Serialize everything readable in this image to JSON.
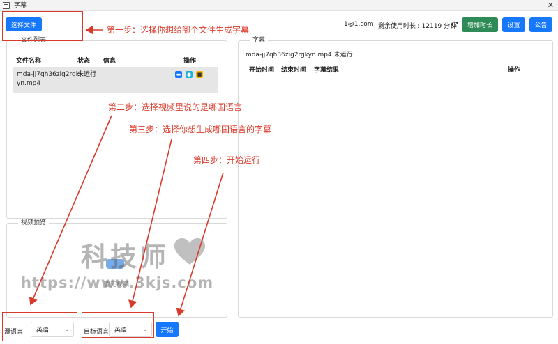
{
  "window": {
    "title": "字幕",
    "close_glyph": "✕"
  },
  "toolbar": {
    "select_file_label": "选择文件",
    "account": "1@1.com",
    "remaining_time_text": "| 剩余使用时长 : 12119 分钟",
    "add_time_label": "增加时长",
    "settings_label": "设置",
    "announcement_label": "公告"
  },
  "file_list": {
    "legend": "文件列表",
    "columns": [
      "文件名称",
      "状态",
      "信息",
      "操作"
    ],
    "rows": [
      {
        "name_line1": "mda-jj7qh36zig2rgk",
        "name_line2": "yn.mp4",
        "status": "未运行",
        "info": ""
      }
    ]
  },
  "video_preview": {
    "legend": "视频预览",
    "placeholder_text": "暂无视频"
  },
  "subtitle_panel": {
    "legend": "字幕",
    "file_status": "mda-jj7qh36zig2rgkyn.mp4 未运行",
    "columns": [
      "开始时间",
      "结束时间",
      "字幕结果",
      "操作"
    ]
  },
  "bottom": {
    "source_language_label": "源语言:",
    "source_language_value": "英语",
    "target_language_label": "目标语言:",
    "target_language_value": "英语",
    "start_label": "开始"
  },
  "annotations": {
    "step1": "第一步：选择你想给哪个文件生成字幕",
    "step2": "第二步：选择视频里说的是哪国语言",
    "step3": "第三步：选择你想生成哪国语言的字幕",
    "step4": "第四步：开始运行"
  },
  "watermark": {
    "line1": "科技师",
    "line2": "https://www.3kjs.com"
  },
  "colors": {
    "primary": "#1677ff",
    "green": "#2e8b57",
    "annotation_red": "#d93a2a"
  }
}
